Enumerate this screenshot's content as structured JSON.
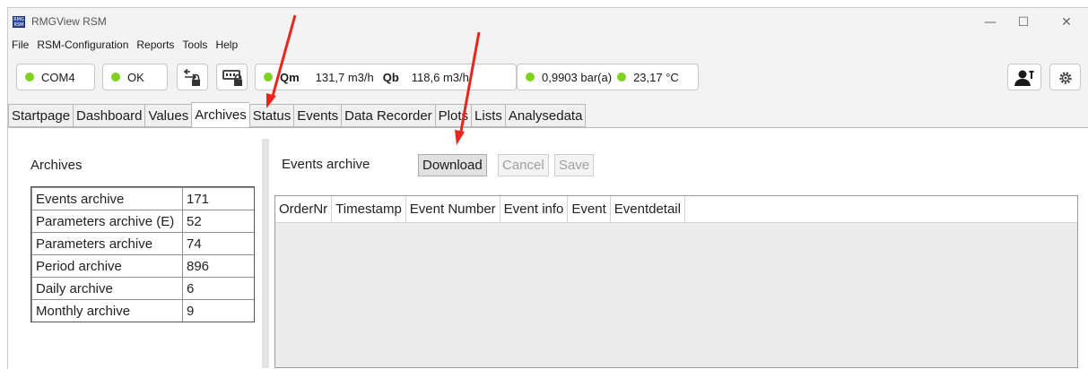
{
  "window": {
    "title": "RMGView RSM",
    "app_icon_text": "RMG RSM",
    "minimize_glyph": "—",
    "maximize_glyph": "☐",
    "close_glyph": "✕"
  },
  "menu": [
    "File",
    "RSM-Configuration",
    "Reports",
    "Tools",
    "Help"
  ],
  "toolbar": {
    "port": "COM4",
    "status": "OK",
    "qm_label": "Qm",
    "qm_value": "131,7 m3/h",
    "qb_label": "Qb",
    "qb_value": "118,6 m3/h",
    "pressure": "0,9903 bar(a)",
    "temperature": "23,17 °C",
    "led_color": "#7ed321",
    "icons": [
      "network-lock-icon",
      "device-lock-icon",
      "user-settings-icon",
      "gear-icon"
    ]
  },
  "tabs": [
    "Startpage",
    "Dashboard",
    "Values",
    "Archives",
    "Status",
    "Events",
    "Data Recorder",
    "Plots",
    "Lists",
    "Analysedata"
  ],
  "active_tab": "Archives",
  "archives": {
    "heading": "Archives",
    "rows": [
      {
        "name": "Events archive",
        "count": "171"
      },
      {
        "name": "Parameters archive (E)",
        "count": "52"
      },
      {
        "name": "Parameters archive",
        "count": "74"
      },
      {
        "name": "Period archive",
        "count": "896"
      },
      {
        "name": "Daily archive",
        "count": "6"
      },
      {
        "name": "Monthly archive",
        "count": "9"
      }
    ]
  },
  "detail": {
    "heading": "Events archive",
    "download_label": "Download",
    "cancel_label": "Cancel",
    "save_label": "Save",
    "columns": [
      "OrderNr",
      "Timestamp",
      "Event Number",
      "Event info",
      "Event",
      "Eventdetail"
    ]
  },
  "annotation_color": "#e8261c"
}
